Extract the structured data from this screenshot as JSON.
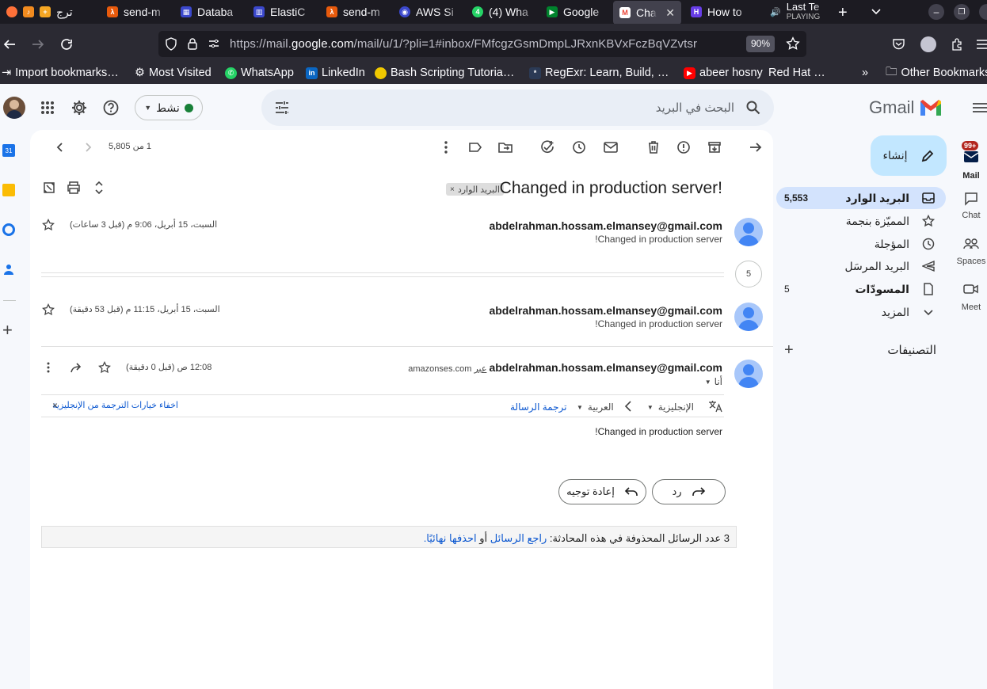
{
  "browser": {
    "tabs": [
      {
        "title": "ترج",
        "icon": "firefox-icon"
      },
      {
        "title": "send-m",
        "icon": "aws-icon"
      },
      {
        "title": "Databa",
        "icon": "database-icon"
      },
      {
        "title": "ElastiC",
        "icon": "elasticache-icon"
      },
      {
        "title": "send-m",
        "icon": "aws-icon"
      },
      {
        "title": "AWS Si",
        "icon": "aws-simple-icon"
      },
      {
        "title": "(4) Wha",
        "icon": "whatsapp-icon"
      },
      {
        "title": "Google",
        "icon": "google-meet-icon"
      },
      {
        "title": "Chan",
        "icon": "gmail-icon"
      },
      {
        "title": "How to",
        "icon": "hostinger-icon"
      },
      {
        "title": "Last Te",
        "subtitle": "PLAYING",
        "icon": "speaker-icon"
      }
    ],
    "url_prefix": "https://mail.",
    "url_domain": "google.com",
    "url_rest": "/mail/u/1/?pli=1#inbox/FMfcgzGsmDmpLJRxnKBVxFczBqVZvtsr",
    "zoom": "90%",
    "bookmarks": [
      "Import bookmarks…",
      "Most Visited",
      "WhatsApp",
      "LinkedIn",
      "Bash Scripting Tutoria…",
      "RegExr: Learn, Build, …",
      "abeer hosny",
      "Red Hat …"
    ],
    "other_bookmarks": "Other Bookmarks"
  },
  "gmail": {
    "brand": "Gmail",
    "search_placeholder": "البحث في البريد",
    "status_label": "نشط",
    "compose_label": "إنشاء",
    "nav": [
      {
        "label": "البريد الوارد",
        "count": "5,553",
        "icon": "inbox-icon"
      },
      {
        "label": "المميّزة بنجمة",
        "count": "",
        "icon": "star-icon"
      },
      {
        "label": "المؤجلة",
        "count": "",
        "icon": "clock-icon"
      },
      {
        "label": "البريد المرسَل",
        "count": "",
        "icon": "send-icon"
      },
      {
        "label": "المسودّات",
        "count": "5",
        "icon": "draft-icon"
      },
      {
        "label": "المزيد",
        "count": "",
        "icon": "chevron-down-icon"
      }
    ],
    "labels_title": "التصنيفات",
    "rail": [
      {
        "label": "Mail",
        "badge": "99+"
      },
      {
        "label": "Chat"
      },
      {
        "label": "Spaces"
      },
      {
        "label": "Meet"
      }
    ],
    "pagination": "1 من 5,805",
    "subject": "Changed in production server!",
    "inbox_chip": "البريد الوارد",
    "messages": [
      {
        "sender": "abdelrahman.hossam.elmansey@gmail.com",
        "snippet": "Changed in production server!",
        "date": "السبت، 15 أبريل، 9:06 م (قبل 3 ساعات)"
      },
      {
        "sender": "abdelrahman.hossam.elmansey@gmail.com",
        "snippet": "Changed in production server!",
        "date": "السبت، 15 أبريل، 11:15 م (قبل 53 دقيقة)"
      },
      {
        "sender": "abdelrahman.hossam.elmansey@gmail.com",
        "via_label": "عبر",
        "via_domain": "amazonses.com",
        "to": "أنا",
        "date": "12:08 ص (قبل 0 دقيقة)",
        "body": "Changed in production server!"
      }
    ],
    "collapsed_count": "5",
    "translate": {
      "from": "الإنجليزية",
      "to": "العربية",
      "action": "ترجمة الرسالة",
      "hide": "اخفاء خيارات الترجمة من الإنجليزية"
    },
    "reply_label": "رد",
    "forward_label": "إعادة توجيه",
    "deleted_notice": {
      "prefix": "3 عدد الرسائل المحذوفة في هذه المحادثة:",
      "review_link": "راجع الرسائل",
      "or": "أو",
      "delete_link": "احذفها نهائيًا."
    }
  }
}
